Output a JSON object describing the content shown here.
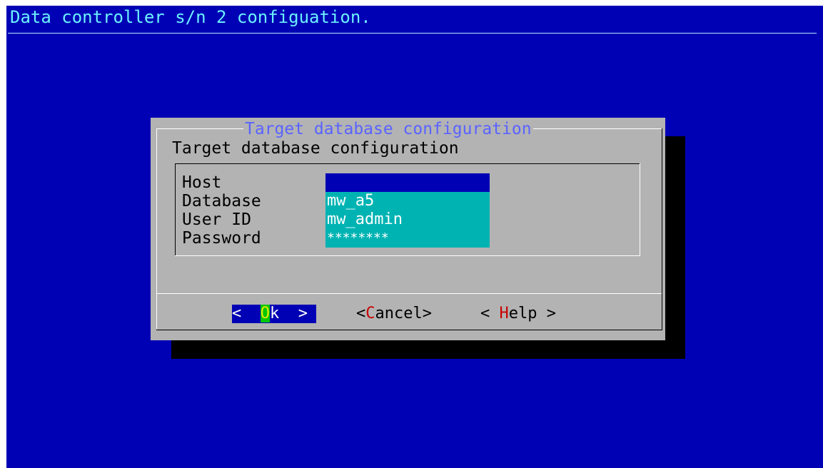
{
  "backtitle": "Data controller s/n 2 configuation.",
  "dialog": {
    "title": "Target database configuration",
    "prompt": "Target database configuration",
    "fields": [
      {
        "label": "Host",
        "value": ""
      },
      {
        "label": "Database",
        "value": "mw_a5"
      },
      {
        "label": "User ID",
        "value": "mw_admin"
      },
      {
        "label": "Password",
        "value": "********"
      }
    ],
    "buttons": {
      "ok": {
        "left": "<  ",
        "hotkey": "O",
        "rest": "k  >"
      },
      "cancel": {
        "left": "<",
        "hotkey": "C",
        "rest": "ancel>"
      },
      "help": {
        "left": "< ",
        "hotkey": "H",
        "rest": "elp >"
      }
    }
  },
  "colors": {
    "background": "#0000b4",
    "dialog": "#b3b3b3",
    "title": "#5a63ff",
    "input": "#00b3b3",
    "focus_input": "#0000b4",
    "hotkey": "#c80000"
  }
}
